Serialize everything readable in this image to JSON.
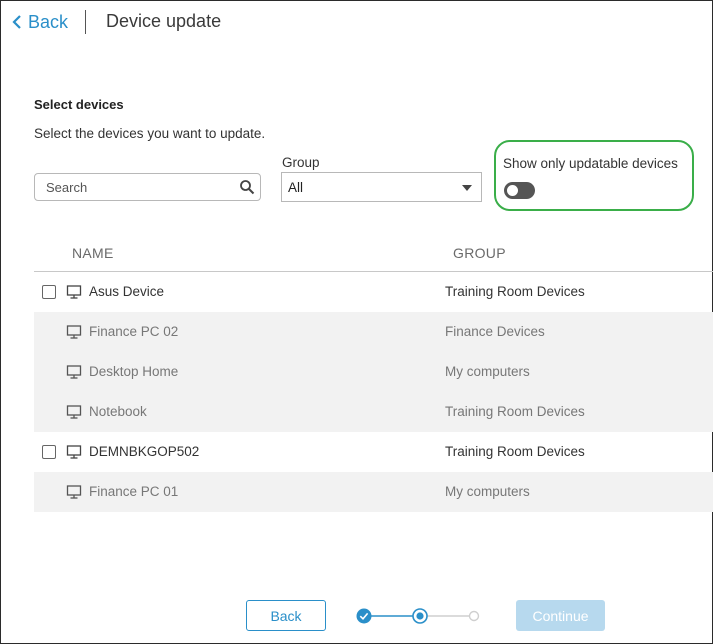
{
  "header": {
    "back_label": "Back",
    "title": "Device update"
  },
  "section": {
    "title": "Select devices",
    "description": "Select the devices you want to update."
  },
  "search": {
    "placeholder": "Search",
    "value": ""
  },
  "group_filter": {
    "label": "Group",
    "selected": "All"
  },
  "updatable_filter": {
    "label": "Show only updatable devices",
    "enabled": false
  },
  "table": {
    "columns": [
      "NAME",
      "GROUP"
    ],
    "rows": [
      {
        "name": "Asus Device",
        "group": "Training Room Devices",
        "selectable": true
      },
      {
        "name": "Finance PC 02",
        "group": "Finance Devices",
        "selectable": false
      },
      {
        "name": "Desktop Home",
        "group": "My computers",
        "selectable": false
      },
      {
        "name": "Notebook",
        "group": "Training Room Devices",
        "selectable": false
      },
      {
        "name": "DEMNBKGOP502",
        "group": "Training Room Devices",
        "selectable": true
      },
      {
        "name": "Finance PC 01",
        "group": "My computers",
        "selectable": false
      }
    ]
  },
  "footer": {
    "back_label": "Back",
    "continue_label": "Continue",
    "steps_total": 3,
    "current_step": 2
  },
  "colors": {
    "accent": "#2a8fc9",
    "highlight": "#3aae49",
    "disabled_button": "#b7d9ee",
    "disabled_row": "#f2f2f2"
  },
  "icons": [
    "chevron-left-icon",
    "search-icon",
    "caret-down-icon",
    "monitor-icon",
    "step-complete-icon"
  ]
}
